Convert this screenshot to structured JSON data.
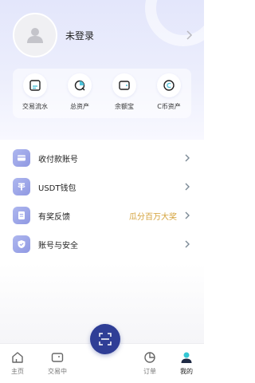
{
  "profile": {
    "username": "未登录"
  },
  "quick_actions": [
    {
      "label": "交易流水",
      "icon": "transaction-flow-icon"
    },
    {
      "label": "总资产",
      "icon": "total-assets-icon"
    },
    {
      "label": "余额宝",
      "icon": "wallet-icon"
    },
    {
      "label": "C币资产",
      "icon": "c-coin-icon"
    }
  ],
  "menu": [
    {
      "label": "收付款账号",
      "icon": "card-icon",
      "extra": ""
    },
    {
      "label": "USDT钱包",
      "icon": "usdt-icon",
      "extra": ""
    },
    {
      "label": "有奖反馈",
      "icon": "feedback-icon",
      "extra": "瓜分百万大奖"
    },
    {
      "label": "账号与安全",
      "icon": "shield-icon",
      "extra": ""
    }
  ],
  "tabbar": {
    "tabs": [
      {
        "label": "主页",
        "icon": "home-icon"
      },
      {
        "label": "交易中",
        "icon": "trading-icon"
      },
      {
        "label": "订单",
        "icon": "orders-icon"
      },
      {
        "label": "我的",
        "icon": "profile-icon",
        "active": true
      }
    ],
    "center_icon": "scan-icon"
  },
  "colors": {
    "accent": "#2f3e96",
    "menu_icon": "#9aa3e8",
    "highlight_text": "#d4a23a",
    "active_tab": "#34c7d4"
  }
}
